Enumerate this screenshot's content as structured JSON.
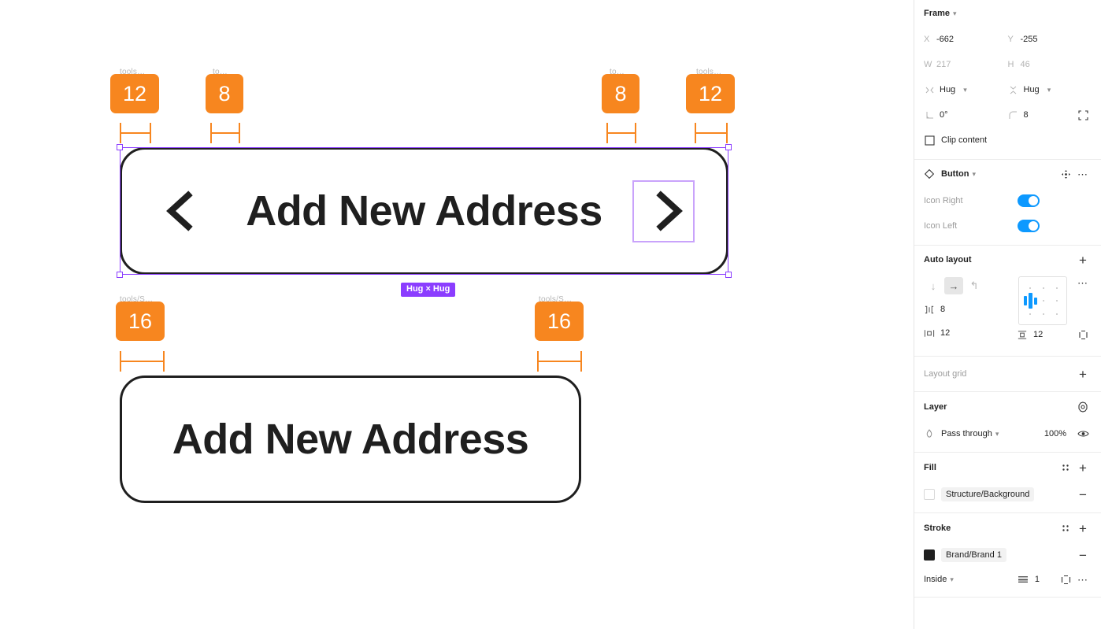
{
  "canvas": {
    "primary_button": {
      "label": "Add New Address",
      "icon_left": "chevron-left-icon",
      "icon_right": "chevron-right-icon"
    },
    "secondary_button": {
      "label": "Add New Address"
    },
    "selection_badge": "Hug × Hug",
    "spacing_badges": [
      {
        "value": "12",
        "caption": "tools…"
      },
      {
        "value": "8",
        "caption": "to…"
      },
      {
        "value": "8",
        "caption": "to…"
      },
      {
        "value": "12",
        "caption": "tools…"
      },
      {
        "value": "16",
        "caption": "tools/S…"
      },
      {
        "value": "16",
        "caption": "tools/S…"
      }
    ]
  },
  "panel": {
    "frame": {
      "title": "Frame",
      "x_label": "X",
      "x_value": "-662",
      "y_label": "Y",
      "y_value": "-255",
      "w_label": "W",
      "w_value": "217",
      "h_label": "H",
      "h_value": "46",
      "horizontal_resize": "Hug",
      "vertical_resize": "Hug",
      "rotation": "0°",
      "corner_radius": "8",
      "clip_content_label": "Clip content"
    },
    "component": {
      "title": "Button",
      "props": [
        {
          "label": "Icon Right",
          "value": "on"
        },
        {
          "label": "Icon Left",
          "value": "on"
        }
      ]
    },
    "auto_layout": {
      "title": "Auto layout",
      "direction_vertical": "arrow-down-icon",
      "direction_horizontal": "arrow-right-icon",
      "direction_wrap": "wrap-icon",
      "gap": "8",
      "padding_horizontal": "12",
      "padding_vertical": "12"
    },
    "layout_grid": {
      "title": "Layout grid"
    },
    "layer": {
      "title": "Layer",
      "blend_mode": "Pass through",
      "opacity": "100%"
    },
    "fill": {
      "title": "Fill",
      "style_name": "Structure/Background",
      "color": "#ffffff"
    },
    "stroke": {
      "title": "Stroke",
      "style_name": "Brand/Brand 1",
      "color": "#1f1f1f",
      "align": "Inside",
      "weight": "1"
    }
  }
}
